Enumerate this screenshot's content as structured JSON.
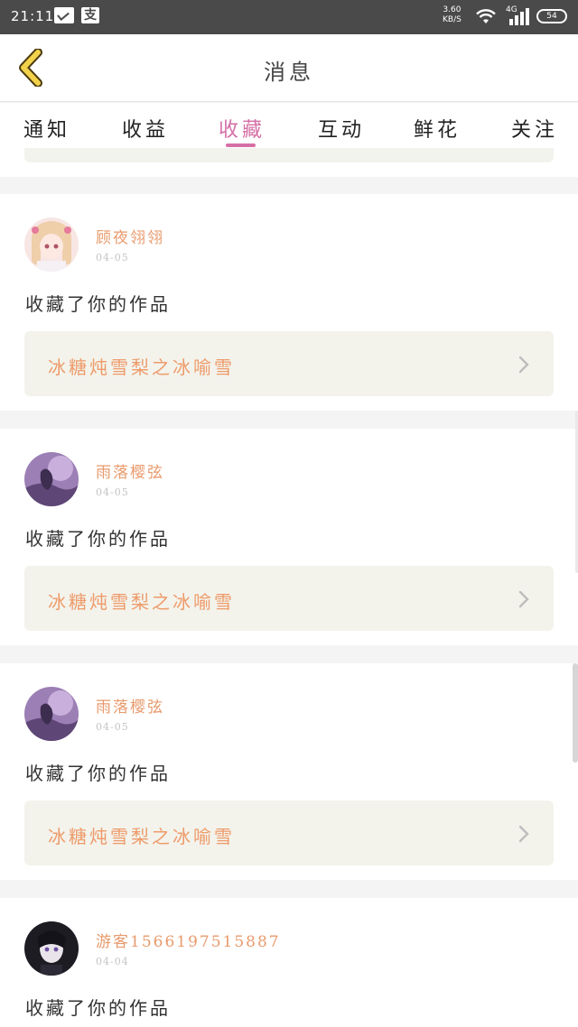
{
  "status_bar": {
    "time": "21:11",
    "speed_value": "3.60",
    "speed_unit": "KB/S",
    "network": "4G",
    "battery": "54"
  },
  "header": {
    "title": "消息"
  },
  "tabs": [
    {
      "label": "通知",
      "active": false
    },
    {
      "label": "收益",
      "active": false
    },
    {
      "label": "收藏",
      "active": true
    },
    {
      "label": "互动",
      "active": false
    },
    {
      "label": "鲜花",
      "active": false
    },
    {
      "label": "关注",
      "active": false
    }
  ],
  "messages": [
    {
      "username": "顾夜翎翎",
      "date": "04-05",
      "action": "收藏了你的作品",
      "work_title": "冰糖炖雪梨之冰喻雪",
      "avatar": "anime-girl-avatar"
    },
    {
      "username": "雨落樱弦",
      "date": "04-05",
      "action": "收藏了你的作品",
      "work_title": "冰糖炖雪梨之冰喻雪",
      "avatar": "purple-night-avatar"
    },
    {
      "username": "雨落樱弦",
      "date": "04-05",
      "action": "收藏了你的作品",
      "work_title": "冰糖炖雪梨之冰喻雪",
      "avatar": "purple-night-avatar"
    },
    {
      "username": "游客1566197515887",
      "date": "04-04",
      "action": "收藏了你的作品",
      "work_title": "",
      "avatar": "dark-hair-avatar"
    }
  ],
  "colors": {
    "accent": "#d66fa6",
    "username": "#e89a6c",
    "work_title": "#ee9b6a",
    "back_arrow": "#f2d24a"
  }
}
